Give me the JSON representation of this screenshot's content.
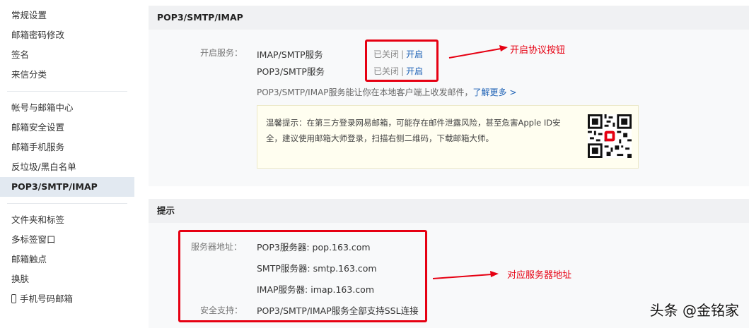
{
  "sidebar": {
    "group1": [
      "常规设置",
      "邮箱密码修改",
      "签名",
      "来信分类"
    ],
    "group2": [
      "帐号与邮箱中心",
      "邮箱安全设置",
      "邮箱手机服务",
      "反垃圾/黑白名单",
      "POP3/SMTP/IMAP"
    ],
    "group3": [
      "文件夹和标签",
      "多标签窗口",
      "邮箱触点",
      "换肤",
      "手机号码邮箱"
    ]
  },
  "section1": {
    "title": "POP3/SMTP/IMAP",
    "open_label": "开启服务：",
    "services": [
      {
        "name": "IMAP/SMTP服务",
        "status": "已关闭",
        "sep": "|",
        "action": "开启"
      },
      {
        "name": "POP3/SMTP服务",
        "status": "已关闭",
        "sep": "|",
        "action": "开启"
      }
    ],
    "desc": "POP3/SMTP/IMAP服务能让你在本地客户端上收发邮件，",
    "learn_more": "了解更多 >",
    "tip_line1": "温馨提示：在第三方登录网易邮箱，可能存在邮件泄露风险，甚至危害Apple ID安",
    "tip_line2": "全，建议使用邮箱大师登录，扫描右侧二维码，下载邮箱大师。"
  },
  "section2": {
    "title": "提示",
    "server_label": "服务器地址：",
    "pop3": "POP3服务器: pop.163.com",
    "smtp": "SMTP服务器: smtp.163.com",
    "imap": "IMAP服务器: imap.163.com",
    "security_label": "安全支持：",
    "security": "POP3/SMTP/IMAP服务全部支持SSL连接"
  },
  "annotations": {
    "top": "开启协议按钮",
    "bottom": "对应服务器地址"
  },
  "watermark": "头条 @金铭家",
  "colors": {
    "accent_red": "#e60012",
    "link_blue": "#1a5fb4",
    "active_bg": "#e2e9f1"
  }
}
